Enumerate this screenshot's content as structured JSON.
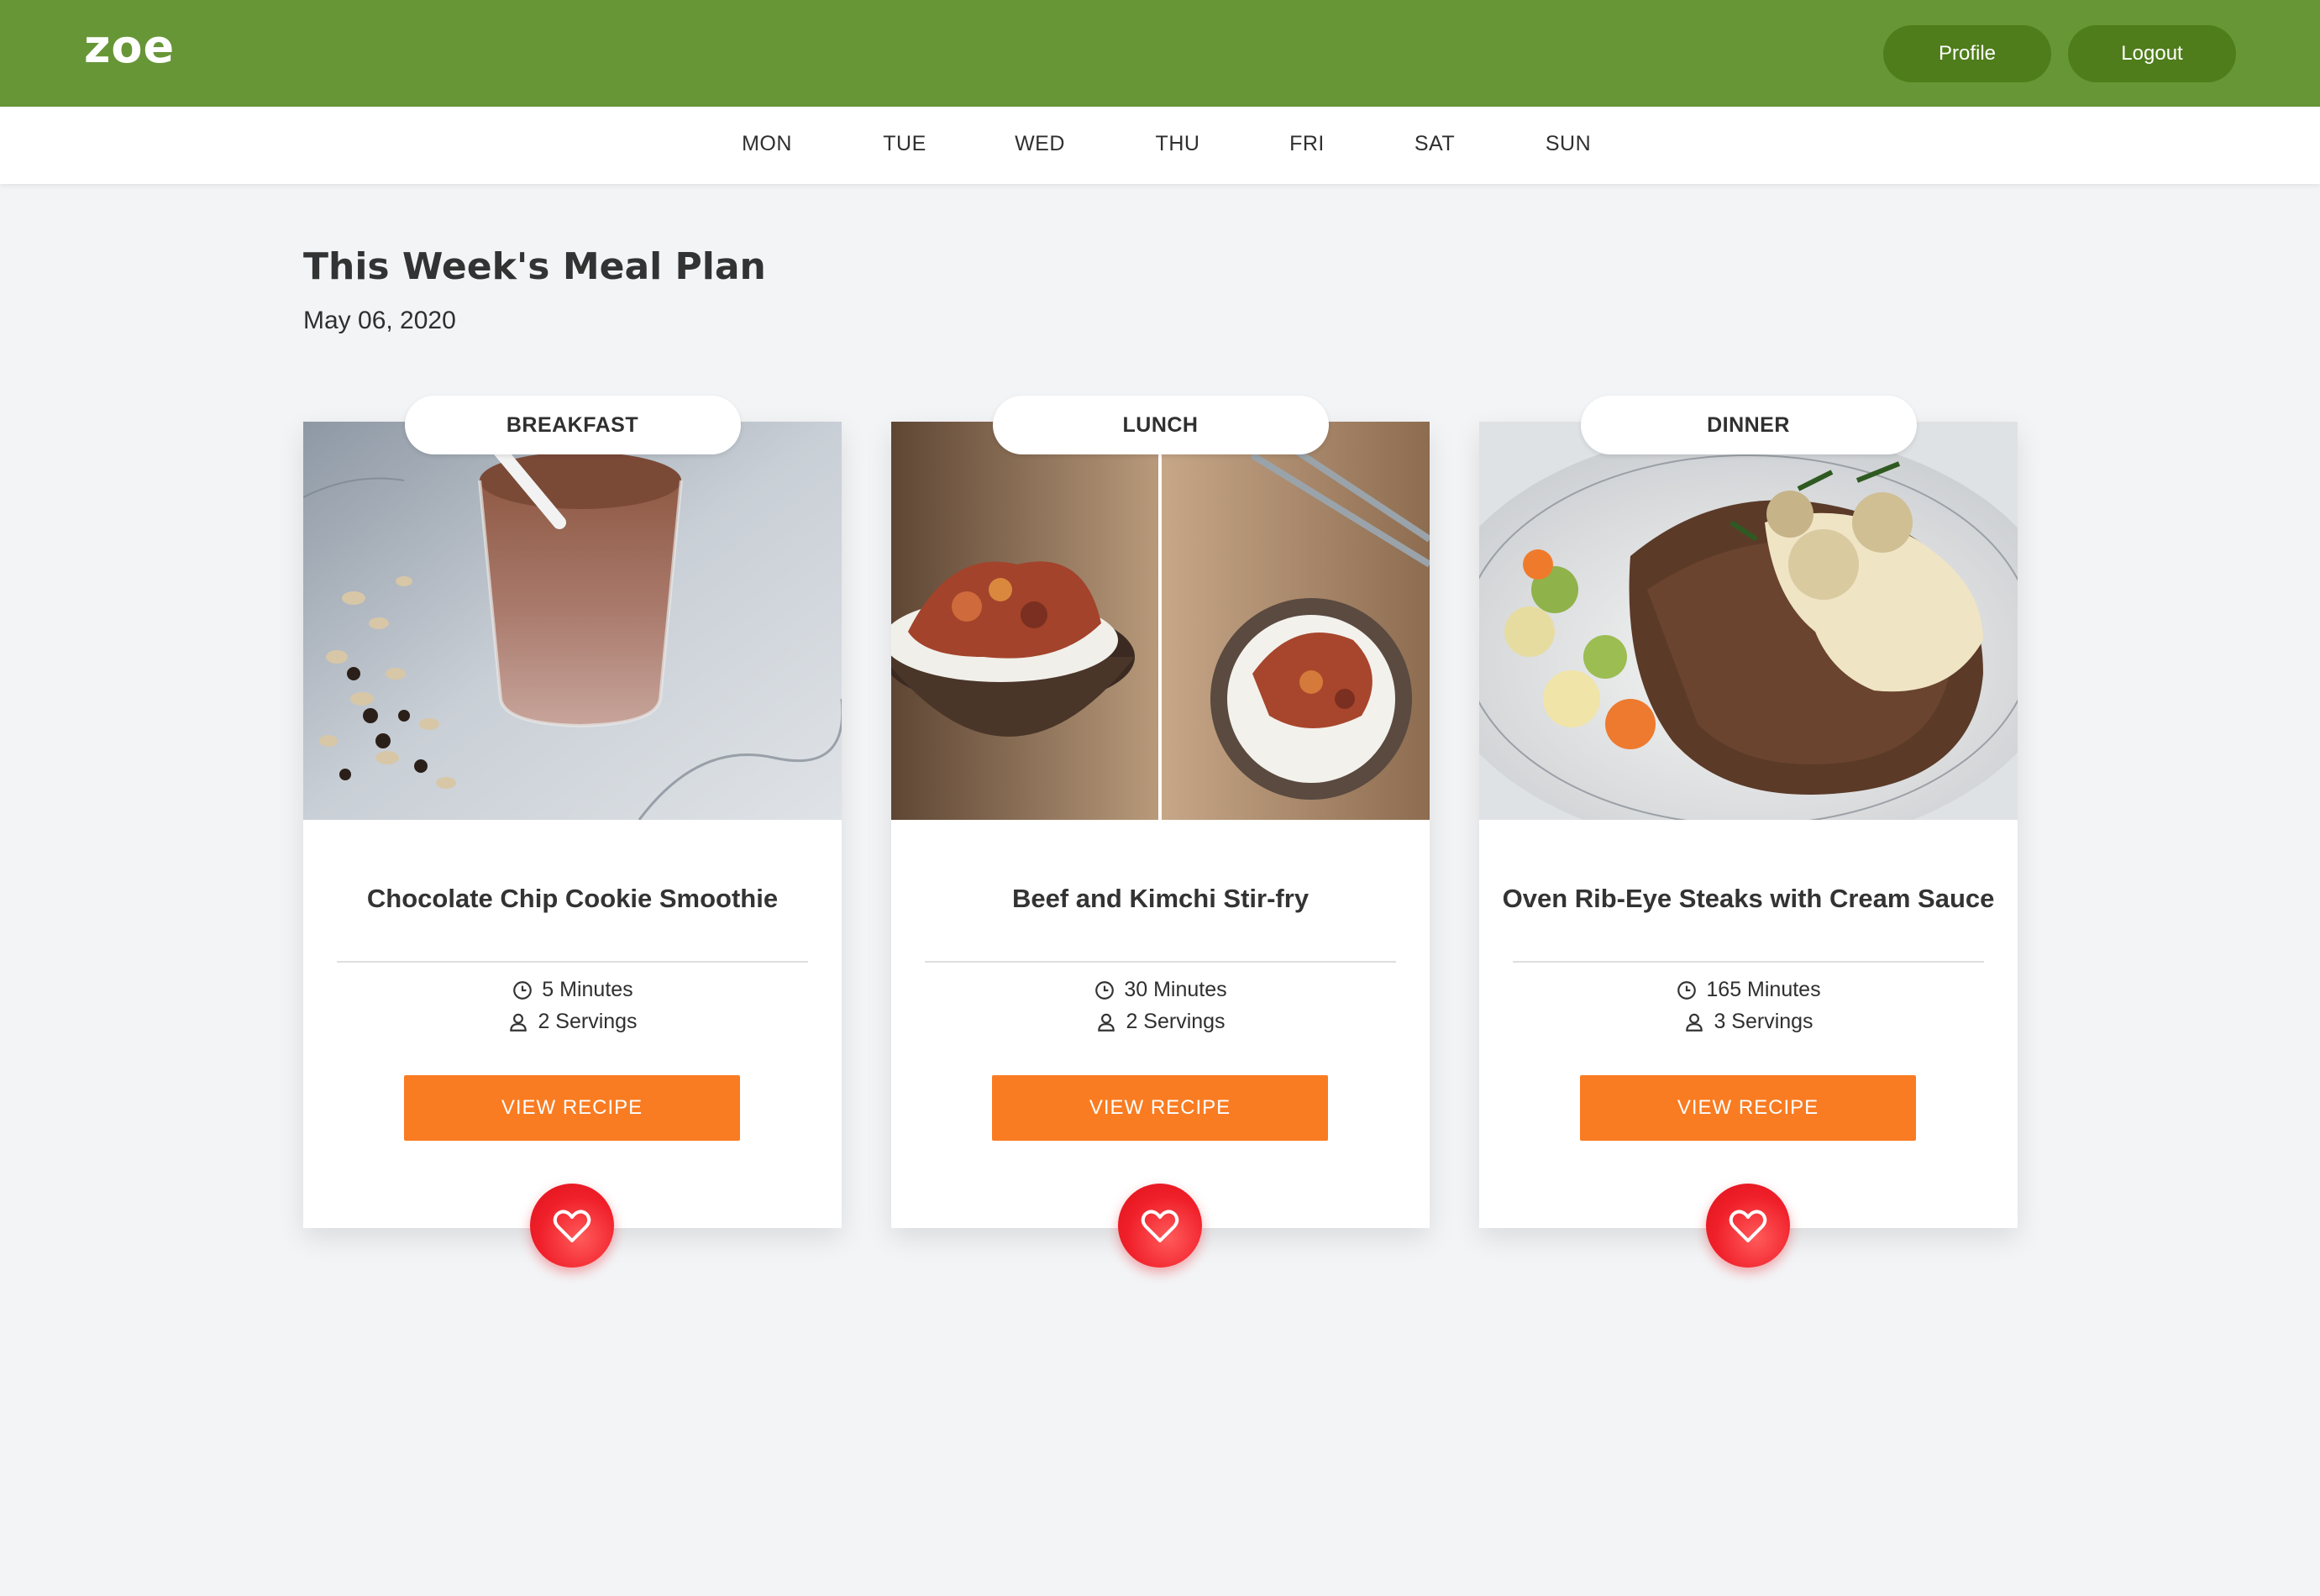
{
  "app": {
    "logo": "zoe"
  },
  "header": {
    "profile_label": "Profile",
    "logout_label": "Logout"
  },
  "days": [
    "MON",
    "TUE",
    "WED",
    "THU",
    "FRI",
    "SAT",
    "SUN"
  ],
  "main": {
    "title": "This Week's Meal Plan",
    "date": "May 06, 2020"
  },
  "meals": [
    {
      "meal": "BREAKFAST",
      "title": "Chocolate Chip Cookie Smoothie",
      "time": "5 Minutes",
      "servings": "2 Servings",
      "button": "VIEW RECIPE"
    },
    {
      "meal": "LUNCH",
      "title": "Beef and Kimchi Stir-fry",
      "time": "30 Minutes",
      "servings": "2 Servings",
      "button": "VIEW RECIPE"
    },
    {
      "meal": "DINNER",
      "title": "Oven Rib-Eye Steaks with Cream Sauce",
      "time": "165 Minutes",
      "servings": "3 Servings",
      "button": "VIEW RECIPE"
    }
  ],
  "colors": {
    "header_bg": "#679637",
    "header_button": "#4f7d1b",
    "view_button": "#f97c22",
    "favorite": "#f0202a",
    "page_bg": "#f3f4f6"
  },
  "icons": {
    "time": "clock-icon",
    "servings": "person-icon",
    "favorite": "heart-icon"
  }
}
